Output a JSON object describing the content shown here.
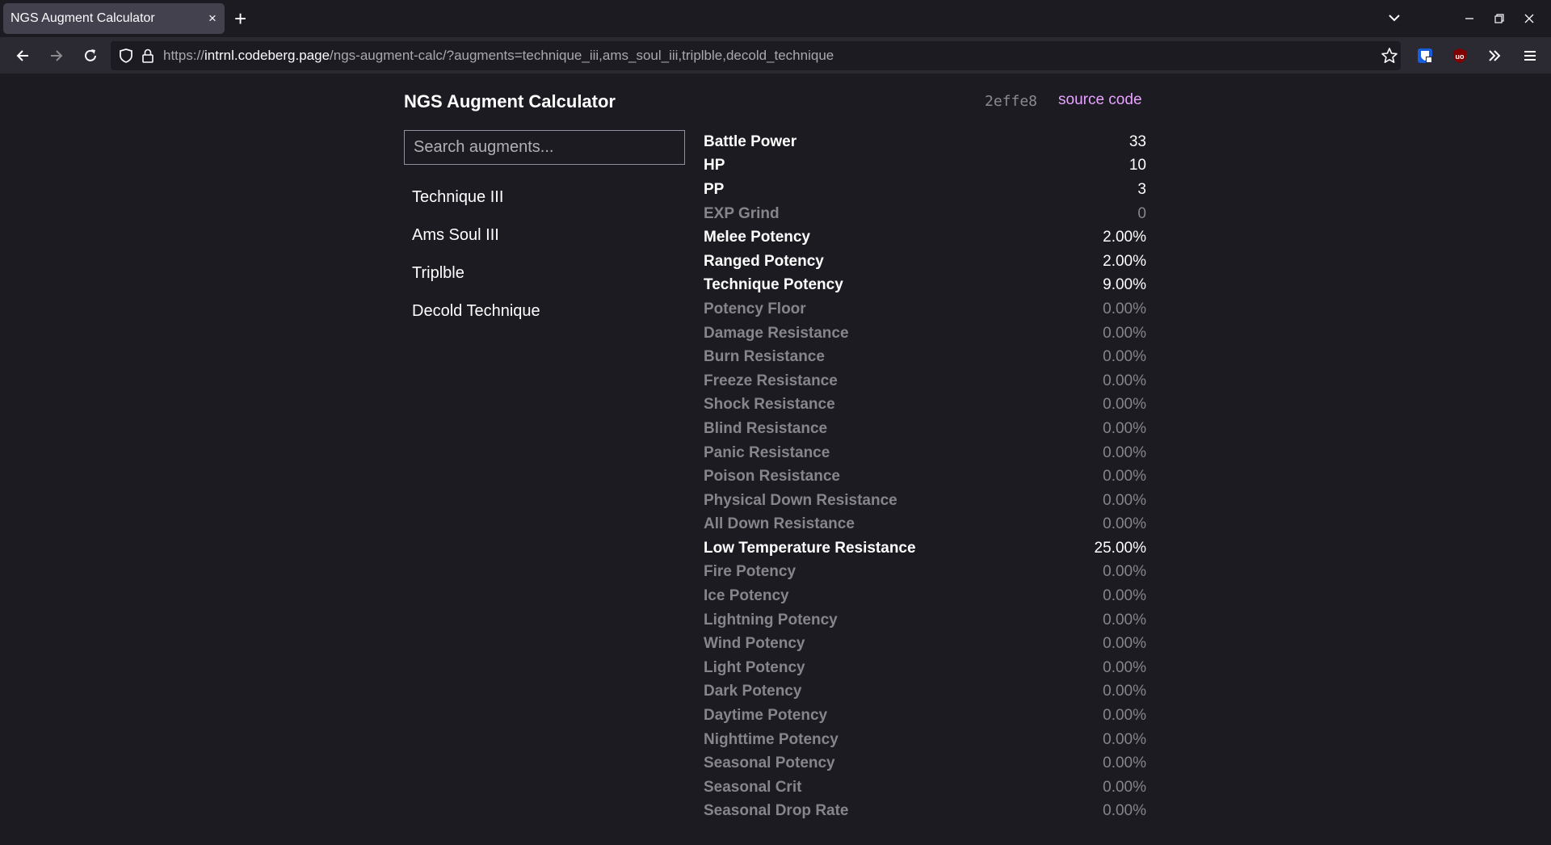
{
  "browser": {
    "tab_title": "NGS Augment Calculator",
    "tab_close": "×",
    "new_tab": "+",
    "url_scheme": "https://",
    "url_host": "intrnl.codeberg.page",
    "url_path": "/ngs-augment-calc/?augments=technique_iii,ams_soul_iii,triplble,decold_technique"
  },
  "app": {
    "title": "NGS Augment Calculator",
    "commit_hash": "2effe8",
    "source_link": "source code",
    "search_placeholder": "Search augments..."
  },
  "augments": [
    "Technique III",
    "Ams Soul III",
    "Triplble",
    "Decold Technique"
  ],
  "stats": [
    {
      "name": "Battle Power",
      "value": "33",
      "active": true
    },
    {
      "name": "HP",
      "value": "10",
      "active": true
    },
    {
      "name": "PP",
      "value": "3",
      "active": true
    },
    {
      "name": "EXP Grind",
      "value": "0",
      "active": false
    },
    {
      "name": "Melee Potency",
      "value": "2.00%",
      "active": true
    },
    {
      "name": "Ranged Potency",
      "value": "2.00%",
      "active": true
    },
    {
      "name": "Technique Potency",
      "value": "9.00%",
      "active": true
    },
    {
      "name": "Potency Floor",
      "value": "0.00%",
      "active": false
    },
    {
      "name": "Damage Resistance",
      "value": "0.00%",
      "active": false
    },
    {
      "name": "Burn Resistance",
      "value": "0.00%",
      "active": false
    },
    {
      "name": "Freeze Resistance",
      "value": "0.00%",
      "active": false
    },
    {
      "name": "Shock Resistance",
      "value": "0.00%",
      "active": false
    },
    {
      "name": "Blind Resistance",
      "value": "0.00%",
      "active": false
    },
    {
      "name": "Panic Resistance",
      "value": "0.00%",
      "active": false
    },
    {
      "name": "Poison Resistance",
      "value": "0.00%",
      "active": false
    },
    {
      "name": "Physical Down Resistance",
      "value": "0.00%",
      "active": false
    },
    {
      "name": "All Down Resistance",
      "value": "0.00%",
      "active": false
    },
    {
      "name": "Low Temperature Resistance",
      "value": "25.00%",
      "active": true
    },
    {
      "name": "Fire Potency",
      "value": "0.00%",
      "active": false
    },
    {
      "name": "Ice Potency",
      "value": "0.00%",
      "active": false
    },
    {
      "name": "Lightning Potency",
      "value": "0.00%",
      "active": false
    },
    {
      "name": "Wind Potency",
      "value": "0.00%",
      "active": false
    },
    {
      "name": "Light Potency",
      "value": "0.00%",
      "active": false
    },
    {
      "name": "Dark Potency",
      "value": "0.00%",
      "active": false
    },
    {
      "name": "Daytime Potency",
      "value": "0.00%",
      "active": false
    },
    {
      "name": "Nighttime Potency",
      "value": "0.00%",
      "active": false
    },
    {
      "name": "Seasonal Potency",
      "value": "0.00%",
      "active": false
    },
    {
      "name": "Seasonal Crit",
      "value": "0.00%",
      "active": false
    },
    {
      "name": "Seasonal Drop Rate",
      "value": "0.00%",
      "active": false
    }
  ]
}
